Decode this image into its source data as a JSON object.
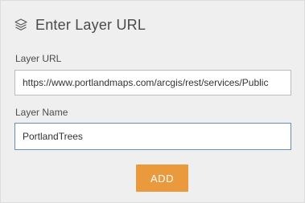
{
  "dialog": {
    "title": "Enter Layer URL",
    "icon": "layers-icon"
  },
  "form": {
    "url_label": "Layer URL",
    "url_value": "https://www.portlandmaps.com/arcgis/rest/services/Public",
    "name_label": "Layer Name",
    "name_value": "PortlandTrees"
  },
  "actions": {
    "add_label": "ADD"
  },
  "colors": {
    "accent": "#ea9a3c",
    "focus_border": "#6a8fb6",
    "panel_background": "#efefef"
  }
}
